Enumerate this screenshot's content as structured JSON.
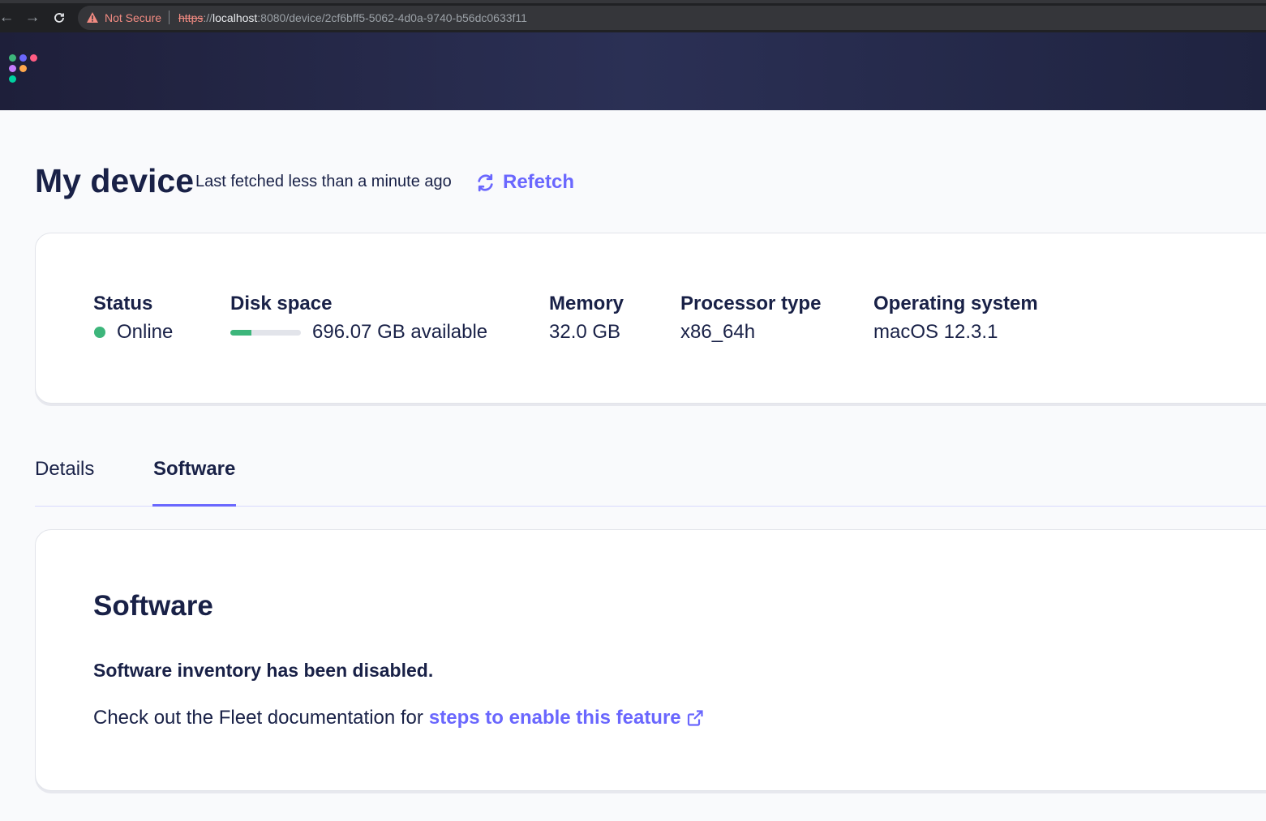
{
  "browser": {
    "security_label": "Not Secure",
    "url_scheme": "https",
    "url_sep": "://",
    "url_host": "localhost",
    "url_rest": ":8080/device/2cf6bff5-5062-4d0a-9740-b56dc0633f11"
  },
  "header": {
    "logo_colors": [
      "#3db67b",
      "#6a67fe",
      "#ff5c83",
      "#c57bfd",
      "#ffa84d",
      "#00d1a0"
    ]
  },
  "page": {
    "title": "My device",
    "last_fetched": "Last fetched less than a minute ago",
    "refetch_label": "Refetch"
  },
  "summary": {
    "status": {
      "label": "Status",
      "value": "Online",
      "color": "#3db67b"
    },
    "disk": {
      "label": "Disk space",
      "value": "696.07 GB available",
      "used_fraction": 0.3
    },
    "memory": {
      "label": "Memory",
      "value": "32.0 GB"
    },
    "processor": {
      "label": "Processor type",
      "value": "x86_64h"
    },
    "os": {
      "label": "Operating system",
      "value": "macOS 12.3.1"
    }
  },
  "tabs": [
    {
      "label": "Details",
      "active": false
    },
    {
      "label": "Software",
      "active": true
    }
  ],
  "software": {
    "title": "Software",
    "disabled_message": "Software inventory has been disabled.",
    "check_text": "Check out the Fleet documentation for",
    "link_text": "steps to enable this feature"
  },
  "colors": {
    "accent": "#6a67fe",
    "text": "#192147",
    "online": "#3db67b"
  }
}
